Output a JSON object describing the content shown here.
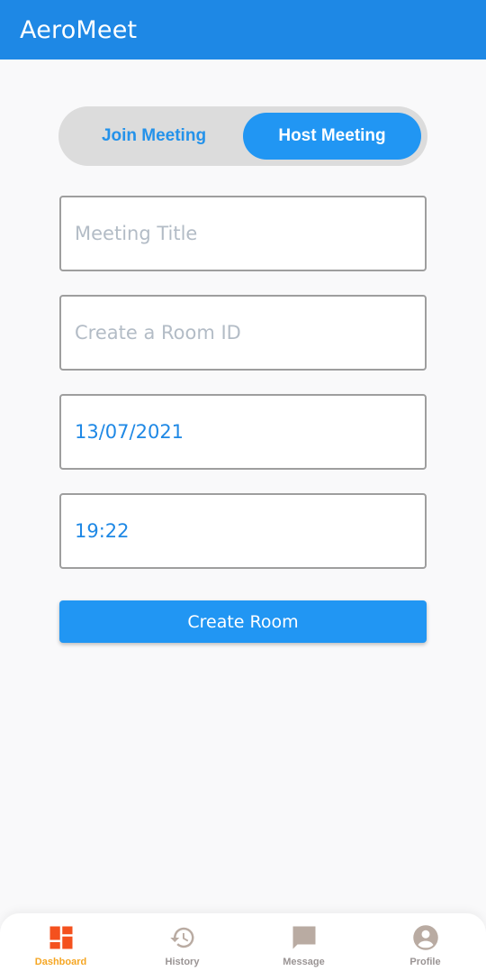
{
  "app": {
    "title": "AeroMeet"
  },
  "toggle": {
    "join_label": "Join Meeting",
    "host_label": "Host Meeting",
    "selected": "Host Meeting"
  },
  "form": {
    "meeting_title": {
      "placeholder": "Meeting Title",
      "value": ""
    },
    "room_id": {
      "placeholder": "Create a Room ID",
      "value": ""
    },
    "date": {
      "value": "13/07/2021"
    },
    "time": {
      "value": "19:22"
    }
  },
  "create_button": {
    "label": "Create Room"
  },
  "bottom_nav": {
    "items": [
      {
        "label": "Dashboard",
        "icon": "dashboard-icon",
        "active": true
      },
      {
        "label": "History",
        "icon": "history-icon",
        "active": false
      },
      {
        "label": "Message",
        "icon": "message-icon",
        "active": false
      },
      {
        "label": "Profile",
        "icon": "profile-icon",
        "active": false
      }
    ]
  },
  "colors": {
    "primary": "#1e88e5",
    "accent_active": "#f4511e",
    "active_label": "#f5a623",
    "inactive_icon": "#b9aba2"
  }
}
